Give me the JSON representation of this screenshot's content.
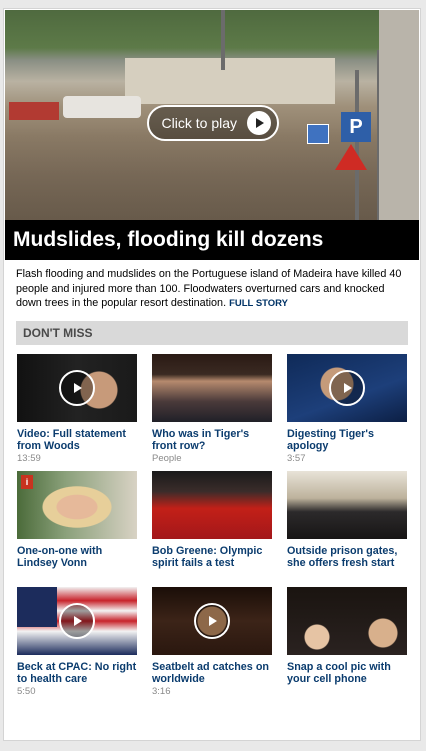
{
  "hero": {
    "play_label": "Click to play",
    "headline": "Mudslides, flooding kill dozens",
    "sign_letter": "P"
  },
  "summary": {
    "text": "Flash flooding and mudslides on the Portuguese island of Madeira have killed 40 people and injured more than 100. Floodwaters overturned cars and knocked down trees in the popular resort destination.",
    "link": "FULL STORY"
  },
  "dont_miss": {
    "title": "DON'T MISS",
    "items": [
      {
        "caption": "Video: Full statement from Woods",
        "meta": "13:59",
        "video": true
      },
      {
        "caption": "Who was in Tiger's front row?",
        "meta": "People",
        "video": false
      },
      {
        "caption": "Digesting Tiger's apology",
        "meta": "3:57",
        "video": true
      },
      {
        "caption": "One-on-one with Lindsey Vonn",
        "meta": "",
        "video": false
      },
      {
        "caption": "Bob Greene: Olympic spirit fails a test",
        "meta": "",
        "video": false
      },
      {
        "caption": "Outside prison gates, she offers fresh start",
        "meta": "",
        "video": false
      },
      {
        "caption": "Beck at CPAC: No right to health care",
        "meta": "5:50",
        "video": true
      },
      {
        "caption": "Seatbelt ad catches on worldwide",
        "meta": "3:16",
        "video": true
      },
      {
        "caption": "Snap a cool pic with your cell phone",
        "meta": "",
        "video": false
      }
    ]
  }
}
